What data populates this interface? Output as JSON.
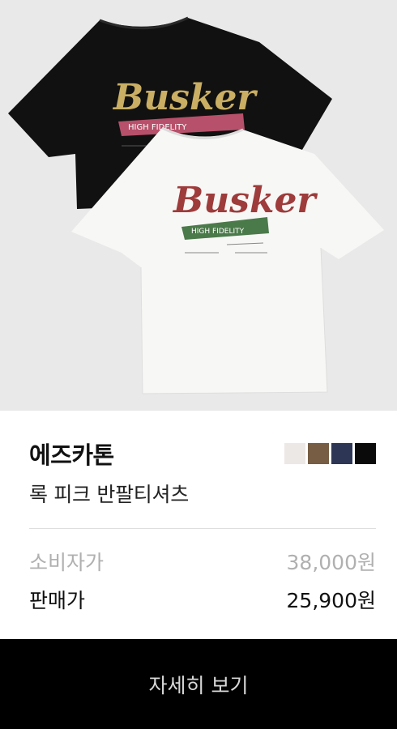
{
  "product": {
    "image_alt": "black and white Busker High Fidelity t-shirts",
    "brand": "에즈카톤",
    "name": "록 피크 반팔티셔츠",
    "colors": [
      "#ece8e6",
      "#765d43",
      "#2d3755",
      "#0a0a0a"
    ],
    "graphic": {
      "logo_text": "Busker",
      "banner_text": "HIGH FIDELITY"
    }
  },
  "pricing": {
    "msrp_label": "소비자가",
    "msrp_value": "38,000원",
    "sale_label": "판매가",
    "sale_value": "25,900원"
  },
  "cta": {
    "label": "자세히 보기"
  }
}
